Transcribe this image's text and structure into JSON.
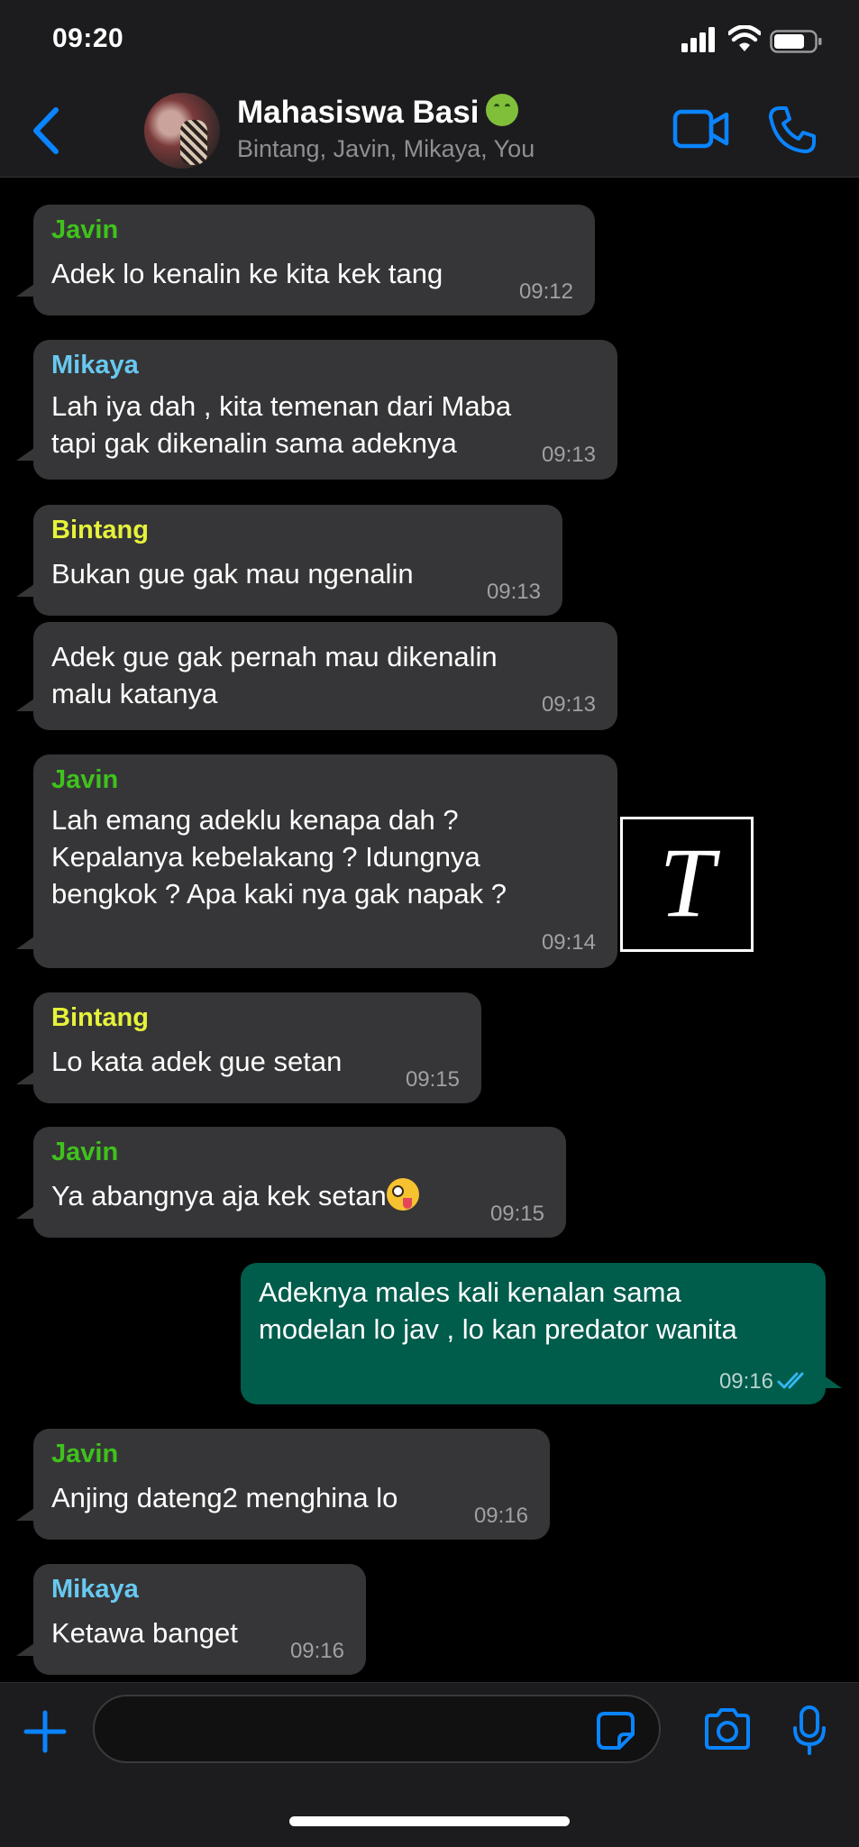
{
  "status_bar": {
    "time": "09:20"
  },
  "header": {
    "title": "Mahasiswa Basi",
    "subtitle": "Bintang, Javin, Mikaya, You",
    "icons": [
      "back-icon",
      "video-call-icon",
      "phone-icon"
    ]
  },
  "messages": [
    {
      "sender": "Javin",
      "sender_color": "#3fc21c",
      "text": "Adek lo kenalin ke kita kek tang",
      "time": "09:12"
    },
    {
      "sender": "Mikaya",
      "sender_color": "#68c9f0",
      "text": "Lah iya dah , kita temenan dari Maba\ntapi gak dikenalin sama adeknya",
      "time": "09:13"
    },
    {
      "sender": "Bintang",
      "sender_color": "#e6f23a",
      "text": "Bukan gue gak mau ngenalin",
      "time": "09:13"
    },
    {
      "sender": "",
      "text": "Adek gue gak pernah mau dikenalin\nmalu katanya",
      "time": "09:13"
    },
    {
      "sender": "Javin",
      "sender_color": "#3fc21c",
      "text": "Lah emang adeklu kenapa dah ?\nKepalanya kebelakang ? Idungnya\nbengkok ? Apa kaki nya gak napak ?",
      "time": "09:14"
    },
    {
      "sender": "Bintang",
      "sender_color": "#e6f23a",
      "text": "Lo kata adek gue setan",
      "time": "09:15"
    },
    {
      "sender": "Javin",
      "sender_color": "#3fc21c",
      "text": "Ya abangnya aja kek setan",
      "time": "09:15",
      "emoji": "zany-face-emoji"
    },
    {
      "sender": "You",
      "outgoing": true,
      "text": "Adeknya males kali kenalan sama\nmodelan lo jav , lo kan predator wanita",
      "time": "09:16",
      "status": "read"
    },
    {
      "sender": "Javin",
      "sender_color": "#3fc21c",
      "text": "Anjing dateng2 menghina lo",
      "time": "09:16"
    },
    {
      "sender": "Mikaya",
      "sender_color": "#68c9f0",
      "text": "Ketawa banget",
      "time": "09:16"
    }
  ],
  "overlay_glyph": "T",
  "colors": {
    "accent": "#0a84ff",
    "incoming_bubble": "#363638",
    "outgoing_bubble": "#005c4b"
  }
}
